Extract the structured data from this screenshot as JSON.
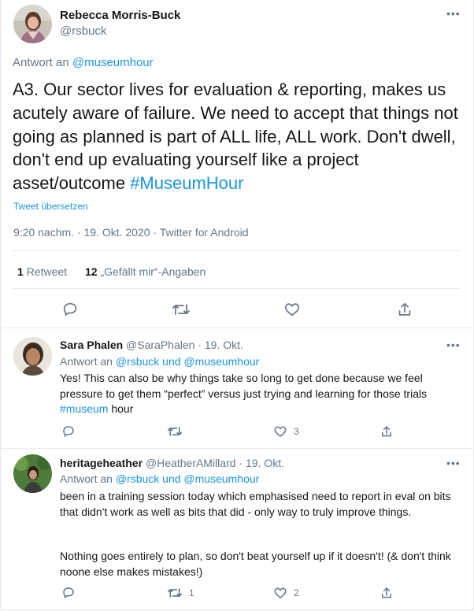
{
  "main_tweet": {
    "name": "Rebecca Morris-Buck",
    "handle": "@rsbuck",
    "reply_prefix": "Antwort an ",
    "reply_to": "@museumhour",
    "text": "A3. Our sector lives for evaluation & reporting, makes us acutely aware of failure. We need to accept that things not going as planned is part of ALL life, ALL work. Don't dwell, don't end up evaluating yourself like a project asset/outcome ",
    "hashtag": "#MuseumHour",
    "translate": "Tweet übersetzen",
    "meta": "9:20 nachm. · 19. Okt. 2020 · Twitter for Android",
    "retweet_count": "1",
    "retweet_label": "Retweet",
    "like_count": "12",
    "like_label": "„Gefällt mir“-Angaben"
  },
  "replies": [
    {
      "name": "Sara Phalen",
      "handle": "@SaraPhalen",
      "date": "· 19. Okt.",
      "reply_prefix": "Antwort an ",
      "reply_to": "@rsbuck und @museumhour",
      "text": "Yes! This can also be why things take so long to get done because we feel pressure to get them “perfect” versus just trying and learning for those trials ",
      "hashtag": "#museum",
      "text_after": " hour",
      "like_count": "3"
    },
    {
      "name": "heritageheather",
      "handle": "@HeatherAMillard",
      "date": "· 19. Okt.",
      "reply_prefix": "Antwort an ",
      "reply_to": "@rsbuck und @museumhour",
      "text_p1": "been in a training session today which emphasised need to report in eval on bits that didn't work as well as bits that did - only way to truly improve things.",
      "text_p2": "Nothing goes entirely to plan, so don't beat yourself up if it doesn't! (& don't think noone else makes mistakes!)",
      "retweet_count": "1",
      "like_count": "2"
    }
  ],
  "icons": {
    "more": "more-icon",
    "reply": "reply-icon",
    "retweet": "retweet-icon",
    "like": "heart-icon",
    "share": "share-icon"
  },
  "colors": {
    "accent": "#1b95e0",
    "muted": "#657786",
    "text": "#14171a"
  }
}
